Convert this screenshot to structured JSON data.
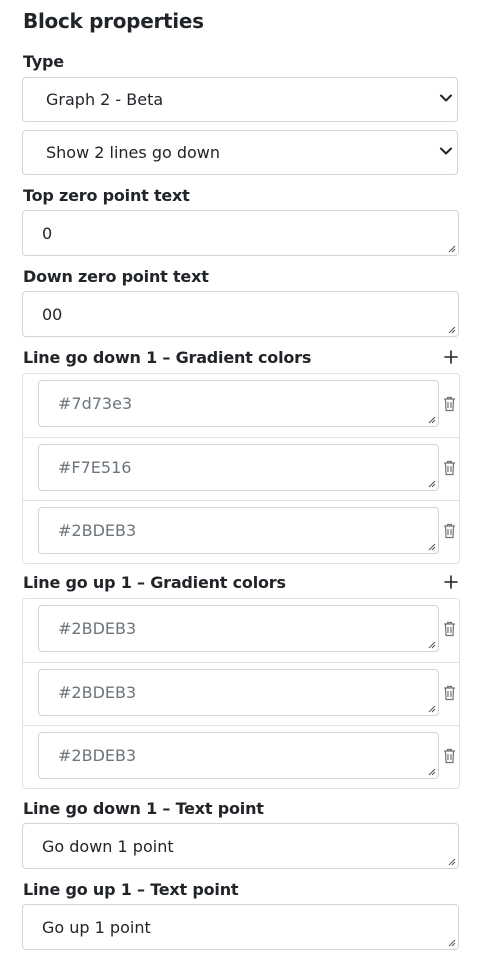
{
  "panel": {
    "title": "Block properties"
  },
  "type_field": {
    "label": "Type",
    "selected": "Graph 2 - Beta",
    "variant_selected": "Show 2 lines go down"
  },
  "top_zero": {
    "label": "Top zero point text",
    "value": "0"
  },
  "down_zero": {
    "label": "Down zero point text",
    "value": "00"
  },
  "gradient_down": {
    "label": "Line go down 1 – Gradient colors",
    "colors": [
      "#7d73e3",
      "#F7E516",
      "#2BDEB3"
    ]
  },
  "gradient_up": {
    "label": "Line go up 1 – Gradient colors",
    "colors": [
      "#2BDEB3",
      "#2BDEB3",
      "#2BDEB3"
    ]
  },
  "text_down": {
    "label": "Line go down 1 – Text point",
    "value": "Go down 1 point"
  },
  "text_up": {
    "label": "Line go up 1 – Text point",
    "value": "Go up 1 point"
  },
  "icons": {
    "add": "plus-icon",
    "delete": "trash-icon",
    "dropdown": "chevron-down-icon",
    "resize": "resize-grip-icon"
  }
}
